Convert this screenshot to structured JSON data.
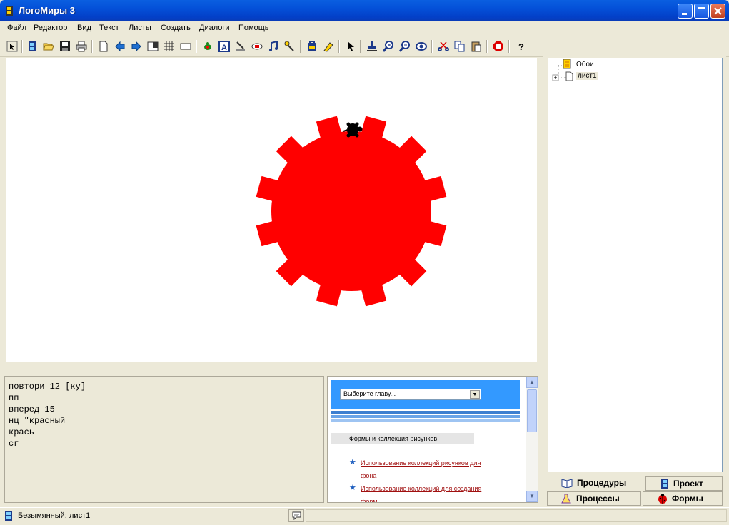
{
  "window": {
    "title": "ЛогоМиры 3"
  },
  "menu": [
    {
      "label": "Файл",
      "accel": "Ф",
      "rest": "айл"
    },
    {
      "label": "Редактор",
      "accel": "Р",
      "rest": "едактор"
    },
    {
      "label": "Вид",
      "accel": "В",
      "rest": "ид"
    },
    {
      "label": "Текст",
      "accel": "Т",
      "rest": "екст"
    },
    {
      "label": "Листы",
      "accel": "Л",
      "rest": "исты"
    },
    {
      "label": "Создать",
      "accel": "С",
      "rest": "оздать"
    },
    {
      "label": "Диалоги",
      "accel": "Д",
      "rest": "иалоги"
    },
    {
      "label": "Помощь",
      "accel": "П",
      "rest": "омощь"
    }
  ],
  "toolbar": {
    "icons": [
      "select-arrow-icon",
      "project-icon",
      "open-folder-icon",
      "save-icon",
      "print-icon",
      "new-page-icon",
      "prev-page-icon",
      "next-page-icon",
      "page-view-icon",
      "grid-icon",
      "rectangle-icon",
      "new-turtle-icon",
      "text-box-icon",
      "button-icon",
      "slider-icon",
      "music-icon",
      "melody-icon",
      "backpack-icon",
      "paint-icon",
      "pointer-icon",
      "stamp-icon",
      "zoom-in-icon",
      "zoom-out-icon",
      "eye-icon",
      "scissors-icon",
      "copy-icon",
      "paste-icon",
      "stop-icon",
      "help-icon"
    ],
    "help_label": "?"
  },
  "shape": {
    "fill": "#ff0000",
    "teeth": 12
  },
  "command_center": {
    "lines": [
      "повтори 12 [ку]",
      "пп",
      "вперед 15",
      "нц \"красный",
      "крась",
      "сг"
    ]
  },
  "help": {
    "select_placeholder": "Выберите главу...",
    "section_title": "Формы и коллекция рисунков",
    "links": [
      {
        "line1": "Использование коллекций рисунков для",
        "line2": "фона"
      },
      {
        "line1": "Использование коллекций для создания",
        "line2": "форм"
      }
    ],
    "colors": {
      "banner": "#3399ff",
      "link": "#a01010"
    }
  },
  "tree": {
    "items": [
      {
        "label": "Обои"
      },
      {
        "label": "лист1"
      }
    ],
    "expand_symbol": "+"
  },
  "tabs": {
    "procedures": "Процедуры",
    "project": "Проект",
    "processes": "Процессы",
    "forms": "Формы"
  },
  "status": {
    "file_label": "Безымянный:",
    "page_label": "лист1"
  }
}
